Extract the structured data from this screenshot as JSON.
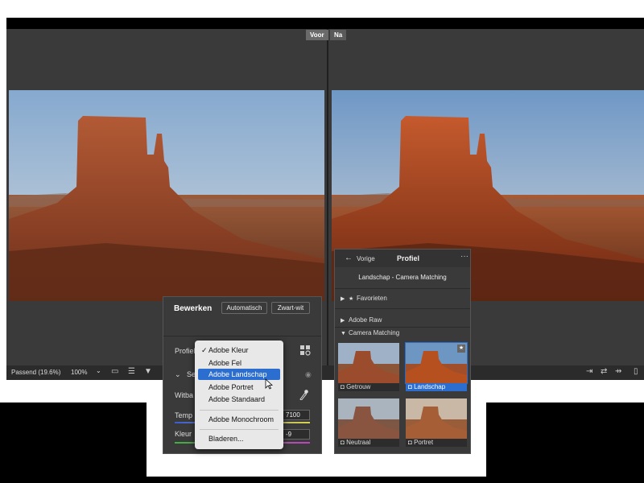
{
  "compare": {
    "before_label": "Voor",
    "after_label": "Na"
  },
  "statusbar": {
    "fit_label": "Passend (19.6%)",
    "zoom_label": "100%",
    "chevron": "⌄"
  },
  "edit_panel": {
    "title": "Bewerken",
    "auto_button": "Automatisch",
    "bw_button": "Zwart-wit",
    "profile_label": "Profiel",
    "section_label": "Se",
    "wb_label": "Witba",
    "temp_label": "Temp",
    "temp_value": "7100",
    "tint_label": "Kleur",
    "tint_value": "-9"
  },
  "profile_dropdown": {
    "checkmark": "✓",
    "items": [
      "Adobe Kleur",
      "Adobe Fel",
      "Adobe Landschap",
      "Adobe Portret",
      "Adobe Standaard",
      "Adobe Monochroom",
      "Bladeren..."
    ],
    "checked_index": 0,
    "selected_index": 2
  },
  "profile_browser": {
    "back_label": "Vorige",
    "title": "Profiel",
    "more": "···",
    "current_profile": "Landschap - Camera Matching",
    "groups": [
      "Favorieten",
      "Adobe Raw",
      "Camera Matching"
    ],
    "thumbnails": [
      "Getrouw",
      "Landschap",
      "Neutraal",
      "Portret"
    ],
    "selected_thumbnail": "Landschap"
  },
  "colors": {
    "accent": "#2b6ed0",
    "panel": "#3a3a3a",
    "statusbar": "#2b2b2b"
  }
}
